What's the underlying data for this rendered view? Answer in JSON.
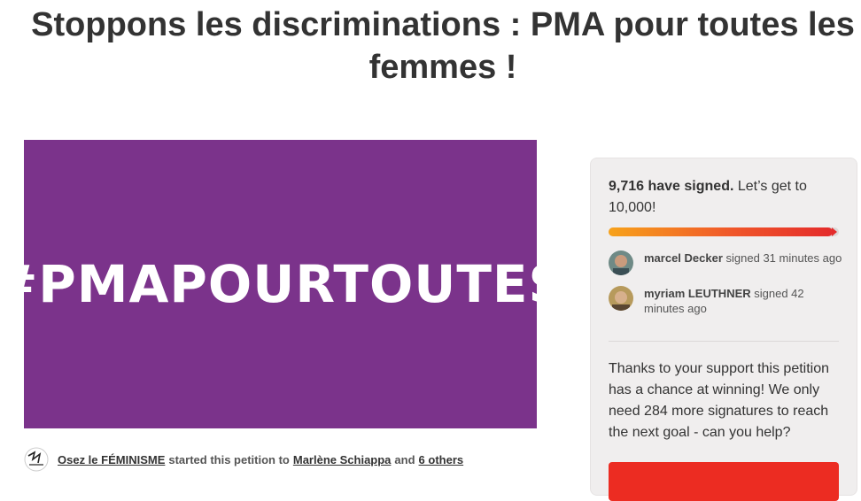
{
  "petition": {
    "title": "Stoppons les discriminations : PMA pour toutes les femmes !",
    "hero_text": "#PMAPOURTOUTES",
    "hero_color": "#7b338b"
  },
  "starter": {
    "org": "Osez le FÉMINISME",
    "mid_text": "started this petition to",
    "target": "Marlène Schiappa",
    "and": "and",
    "others": "6 others",
    "logo_icon": "osez-le-feminisme-logo"
  },
  "sidebar": {
    "count_bold": "9,716 have signed.",
    "count_goal": "Let’s get to 10,000!",
    "progress_fraction": 0.9716,
    "signers": [
      {
        "name": "marcel Decker",
        "time": "signed 31 minutes ago"
      },
      {
        "name": "myriam LEUTHNER",
        "time": "signed 42 minutes ago"
      }
    ],
    "support_text": "Thanks to your support this petition has a chance at winning! We only need 284 more signatures to reach the next goal - can you help?",
    "button_color": "#ec2c22"
  }
}
